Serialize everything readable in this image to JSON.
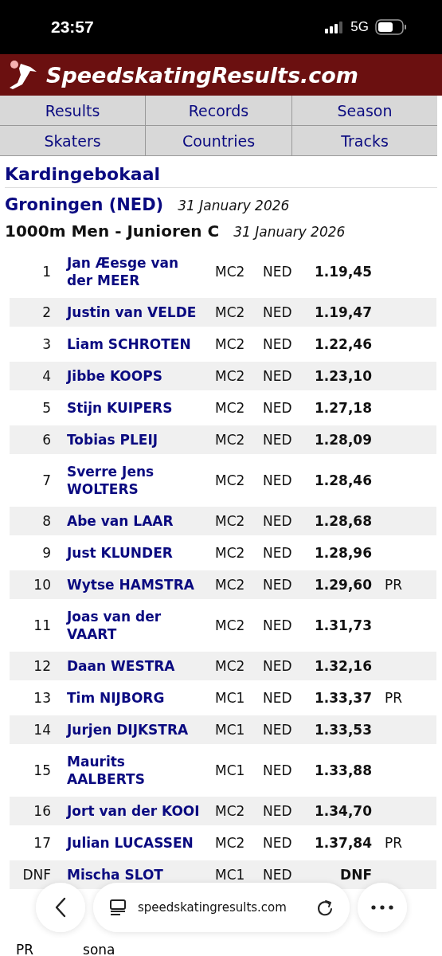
{
  "status_bar": {
    "time": "23:57",
    "network": "5G"
  },
  "site": {
    "title": "SpeedskatingResults.com"
  },
  "nav": [
    {
      "label": "Results"
    },
    {
      "label": "Records"
    },
    {
      "label": "Season"
    },
    {
      "label": "Skaters"
    },
    {
      "label": "Countries"
    },
    {
      "label": "Tracks"
    }
  ],
  "competition": {
    "name": "Kardingebokaal",
    "venue": "Groningen (NED)",
    "date": "31 January 2026"
  },
  "race": {
    "title": "1000m Men - Junioren C",
    "date": "31 January 2026"
  },
  "results": [
    {
      "rank": "1",
      "name": "Jan Æesge van der MEER",
      "category": "MC2",
      "country": "NED",
      "time": "1.19,45"
    },
    {
      "rank": "2",
      "name": "Justin van VELDE",
      "category": "MC2",
      "country": "NED",
      "time": "1.19,47"
    },
    {
      "rank": "3",
      "name": "Liam SCHROTEN",
      "category": "MC2",
      "country": "NED",
      "time": "1.22,46"
    },
    {
      "rank": "4",
      "name": "Jibbe KOOPS",
      "category": "MC2",
      "country": "NED",
      "time": "1.23,10"
    },
    {
      "rank": "5",
      "name": "Stijn KUIPERS",
      "category": "MC2",
      "country": "NED",
      "time": "1.27,18"
    },
    {
      "rank": "6",
      "name": "Tobias PLEIJ",
      "category": "MC2",
      "country": "NED",
      "time": "1.28,09"
    },
    {
      "rank": "7",
      "name": "Sverre Jens WOLTERS",
      "category": "MC2",
      "country": "NED",
      "time": "1.28,46"
    },
    {
      "rank": "8",
      "name": "Abe van LAAR",
      "category": "MC2",
      "country": "NED",
      "time": "1.28,68"
    },
    {
      "rank": "9",
      "name": "Just KLUNDER",
      "category": "MC2",
      "country": "NED",
      "time": "1.28,96"
    },
    {
      "rank": "10",
      "name": "Wytse HAMSTRA",
      "category": "MC2",
      "country": "NED",
      "time": "1.29,60",
      "note": "PR"
    },
    {
      "rank": "11",
      "name": "Joas van der VAART",
      "category": "MC2",
      "country": "NED",
      "time": "1.31,73"
    },
    {
      "rank": "12",
      "name": "Daan WESTRA",
      "category": "MC2",
      "country": "NED",
      "time": "1.32,16"
    },
    {
      "rank": "13",
      "name": "Tim NIJBORG",
      "category": "MC1",
      "country": "NED",
      "time": "1.33,37",
      "note": "PR"
    },
    {
      "rank": "14",
      "name": "Jurjen DIJKSTRA",
      "category": "MC1",
      "country": "NED",
      "time": "1.33,53"
    },
    {
      "rank": "15",
      "name": "Maurits AALBERTS",
      "category": "MC1",
      "country": "NED",
      "time": "1.33,88"
    },
    {
      "rank": "16",
      "name": "Jort van der KOOI",
      "category": "MC2",
      "country": "NED",
      "time": "1.34,70"
    },
    {
      "rank": "17",
      "name": "Julian LUCASSEN",
      "category": "MC2",
      "country": "NED",
      "time": "1.37,84",
      "note": "PR"
    },
    {
      "rank": "DNF",
      "name": "Mischa SLOT",
      "category": "MC1",
      "country": "NED",
      "time": "DNF"
    }
  ],
  "footer": {
    "legend_start": "PR",
    "legend_end": "sona"
  },
  "browser_bar": {
    "url": "speedskatingresults.com"
  }
}
